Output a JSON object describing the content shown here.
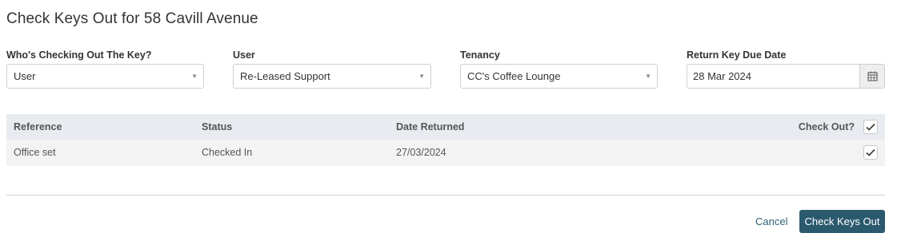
{
  "title": "Check Keys Out for 58 Cavill Avenue",
  "form": {
    "who": {
      "label": "Who's Checking Out The Key?",
      "value": "User"
    },
    "user": {
      "label": "User",
      "value": "Re-Leased Support"
    },
    "tenancy": {
      "label": "Tenancy",
      "value": "CC's Coffee Lounge"
    },
    "return_date": {
      "label": "Return Key Due Date",
      "value": "28 Mar 2024"
    }
  },
  "table": {
    "headers": {
      "reference": "Reference",
      "status": "Status",
      "date_returned": "Date Returned",
      "check_out": "Check Out?"
    },
    "select_all_checked": true,
    "rows": [
      {
        "reference": "Office set",
        "status": "Checked In",
        "date_returned": "27/03/2024",
        "checked": true
      }
    ]
  },
  "actions": {
    "cancel": "Cancel",
    "submit": "Check Keys Out"
  },
  "colors": {
    "primary": "#2b5a6e",
    "header_bg": "#e8ecf1",
    "row_bg": "#f3f3f3"
  }
}
